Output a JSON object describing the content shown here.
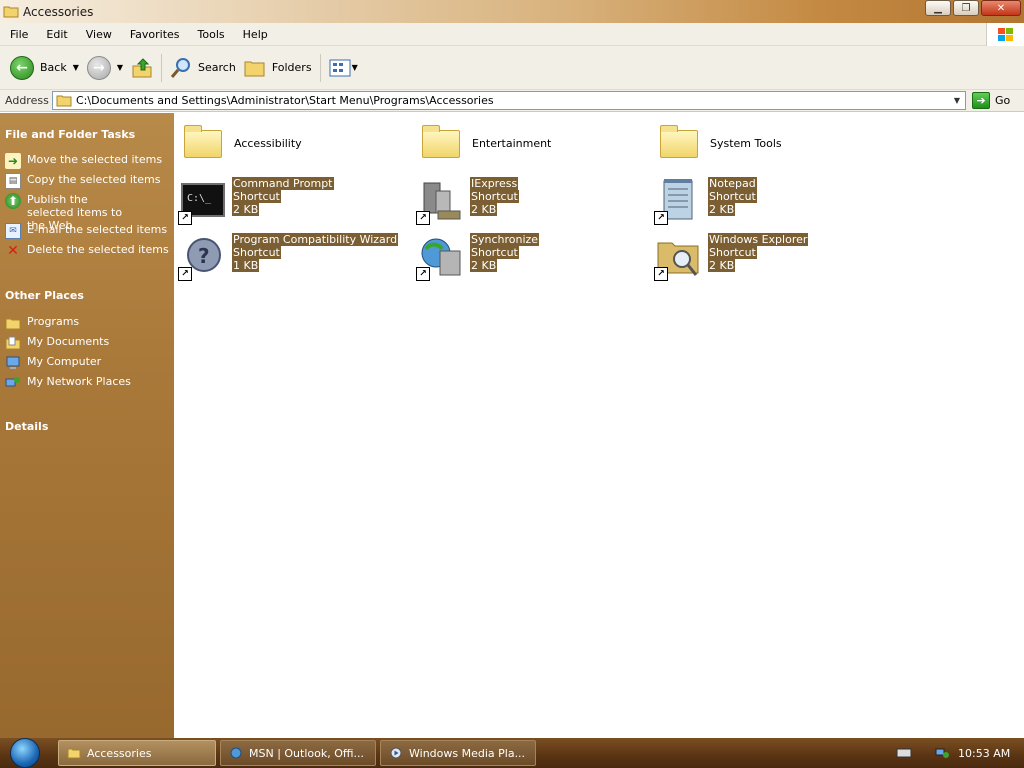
{
  "window": {
    "title": "Accessories"
  },
  "menu": {
    "items": [
      "File",
      "Edit",
      "View",
      "Favorites",
      "Tools",
      "Help"
    ]
  },
  "toolbar": {
    "back": "Back",
    "search": "Search",
    "folders": "Folders"
  },
  "address": {
    "label": "Address",
    "value": "C:\\Documents and Settings\\Administrator\\Start Menu\\Programs\\Accessories",
    "go": "Go"
  },
  "sidebar": {
    "file_tasks": {
      "title": "File and Folder Tasks",
      "items": [
        "Move the selected items",
        "Copy the selected items",
        "Publish the selected items to the Web",
        "E-mail the selected items",
        "Delete the selected items"
      ]
    },
    "other_places": {
      "title": "Other Places",
      "items": [
        "Programs",
        "My Documents",
        "My Computer",
        "My Network Places"
      ]
    },
    "details": {
      "title": "Details"
    }
  },
  "folders": [
    {
      "name": "Accessibility"
    },
    {
      "name": "Entertainment"
    },
    {
      "name": "System Tools"
    }
  ],
  "shortcuts": [
    {
      "name": "Command Prompt",
      "type": "Shortcut",
      "size": "2 KB",
      "icon": "command-prompt-icon"
    },
    {
      "name": "IExpress",
      "type": "Shortcut",
      "size": "2 KB",
      "icon": "iexpress-icon"
    },
    {
      "name": "Notepad",
      "type": "Shortcut",
      "size": "2 KB",
      "icon": "notepad-icon"
    },
    {
      "name": "Program Compatibility Wizard",
      "type": "Shortcut",
      "size": "1 KB",
      "icon": "compatibility-wizard-icon"
    },
    {
      "name": "Synchronize",
      "type": "Shortcut",
      "size": "2 KB",
      "icon": "synchronize-icon"
    },
    {
      "name": "Windows Explorer",
      "type": "Shortcut",
      "size": "2 KB",
      "icon": "windows-explorer-icon"
    }
  ],
  "taskbar": {
    "tasks": [
      "Accessories",
      "MSN | Outlook, Offi...",
      "Windows Media Pla..."
    ],
    "clock": "10:53 AM"
  },
  "colors": {
    "sidebar": "#a9793a",
    "selection": "#7b5e32",
    "taskbar": "#5a3413"
  }
}
